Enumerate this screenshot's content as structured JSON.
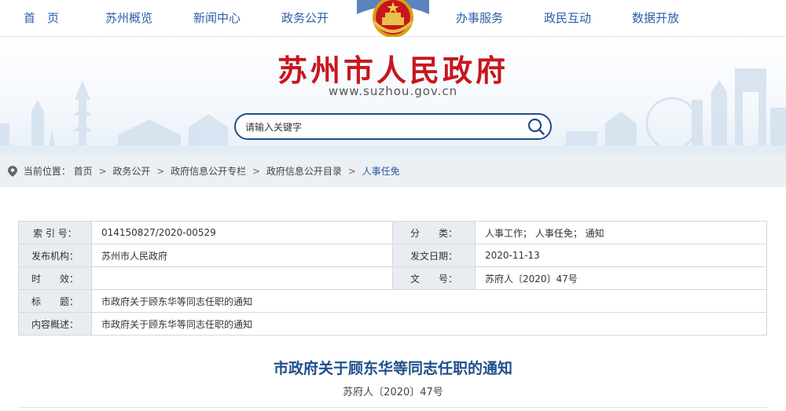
{
  "nav": {
    "items": [
      "首　页",
      "苏州概览",
      "新闻中心",
      "政务公开",
      "办事服务",
      "政民互动",
      "数据开放"
    ]
  },
  "header": {
    "title": "苏州市人民政府",
    "url": "www.suzhou.gov.cn"
  },
  "search": {
    "placeholder": "请输入关键字"
  },
  "breadcrumb": {
    "label": "当前位置：",
    "items": [
      "首页",
      "政务公开",
      "政府信息公开专栏",
      "政府信息公开目录"
    ],
    "current": "人事任免"
  },
  "info": {
    "index_label": "索 引 号：",
    "index_value": "014150827/2020-00529",
    "category_label": "分　　类：",
    "category_value": "人事工作； 人事任免； 通知",
    "publisher_label": "发布机构：",
    "publisher_value": "苏州市人民政府",
    "date_label": "发文日期：",
    "date_value": "2020-11-13",
    "validity_label": "时　　效：",
    "validity_value": "",
    "docno_label": "文　　号：",
    "docno_value": "苏府人〔2020〕47号",
    "subject_label": "标　　题：",
    "subject_value": "市政府关于顾东华等同志任职的通知",
    "summary_label": "内容概述：",
    "summary_value": "市政府关于顾东华等同志任职的通知"
  },
  "document": {
    "title": "市政府关于顾东华等同志任职的通知",
    "number": "苏府人〔2020〕47号"
  },
  "colors": {
    "nav_text": "#2a5ea8",
    "title_red": "#c8161d",
    "doc_title_blue": "#1f4e8c",
    "label_bg": "#e9ecf1"
  },
  "icons": [
    "national-emblem-icon",
    "search-icon",
    "location-pin-icon"
  ]
}
